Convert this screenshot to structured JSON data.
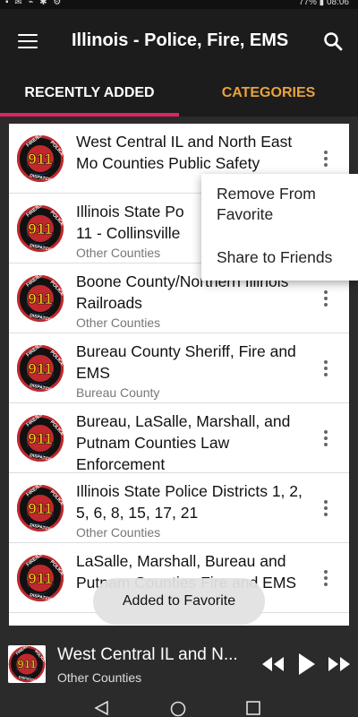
{
  "status_bar": {
    "left": "▪ ✉ ⌁ ✱ ⚙",
    "right": "77% ▮ 08:06"
  },
  "app_bar": {
    "title": "Illinois - Police, Fire, EMS",
    "menu_icon": "menu-icon",
    "search_icon": "search-icon"
  },
  "tabs": [
    {
      "label": "RECENTLY ADDED",
      "active": true
    },
    {
      "label": "CATEGORIES",
      "active": false
    }
  ],
  "colors": {
    "tab_indicator": "#e0245e",
    "tab_inactive": "#e8a23c",
    "app_bar": "#1c1c1c"
  },
  "list": {
    "items": [
      {
        "title": "West Central IL and North East Mo Counties Public Safety",
        "subtitle": ""
      },
      {
        "title": "Illinois State Po 11 - Collinsville",
        "subtitle": "Other Counties"
      },
      {
        "title": "Boone County/Northern Illinois Railroads",
        "subtitle": "Other Counties"
      },
      {
        "title": "Bureau County Sheriff, Fire and EMS",
        "subtitle": "Bureau County"
      },
      {
        "title": "Bureau, LaSalle, Marshall, and Putnam Counties Law Enforcement",
        "subtitle": ""
      },
      {
        "title": "Illinois State Police Districts 1, 2, 5, 6, 8, 15, 17, 21",
        "subtitle": "Other Counties"
      },
      {
        "title": "LaSalle, Marshall, Bureau and Putnam Counties Fire and EMS",
        "subtitle": ""
      }
    ]
  },
  "popup_menu": {
    "remove": "Remove From Favorite",
    "share": "Share to Friends"
  },
  "toast": "Added to Favorite",
  "player": {
    "title": "West Central IL and N...",
    "subtitle": "Other Counties"
  },
  "logo": {
    "top": "FIRE/EMS",
    "right": "POLICE",
    "bottom": "DISPATCH",
    "center": "911"
  }
}
